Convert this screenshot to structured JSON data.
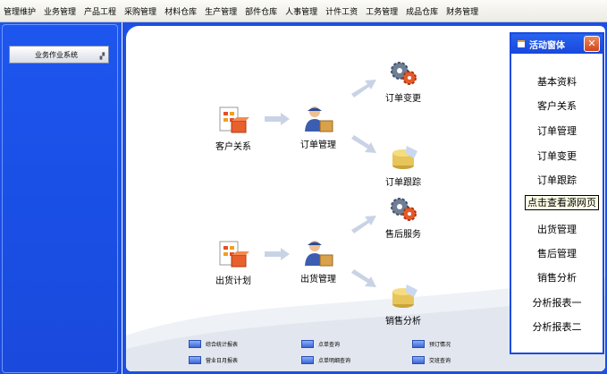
{
  "menu": [
    "管理维护",
    "业务管理",
    "产品工程",
    "采购管理",
    "材料仓库",
    "生产管理",
    "部件仓库",
    "人事管理",
    "计件工资",
    "工务管理",
    "成品仓库",
    "财务管理"
  ],
  "left_panel": {
    "button_label": "业务作业系统"
  },
  "diagram": {
    "row1": {
      "source": "客户关系",
      "hub": "订单管理",
      "up": "订单变更",
      "down": "订单跟踪"
    },
    "row2": {
      "source": "出货计划",
      "hub": "出货管理",
      "up": "售后服务",
      "down": "销售分析"
    }
  },
  "activity_panel": {
    "title": "活动窗体",
    "close": "✕",
    "items": [
      "基本资料",
      "客户关系",
      "订单管理",
      "订单变更",
      "订单跟踪",
      "出货管理",
      "售后管理",
      "销售分析",
      "分析报表一",
      "分析报表二"
    ]
  },
  "tooltip": "点击查看源网页",
  "quick_links": [
    "综合统计报表",
    "点单查询",
    "预订情况",
    "营业日月报表",
    "点单明细查询",
    "交班查询"
  ],
  "colors": {
    "blue": "#1c4fe6",
    "panel_border": "#1b4be0"
  }
}
